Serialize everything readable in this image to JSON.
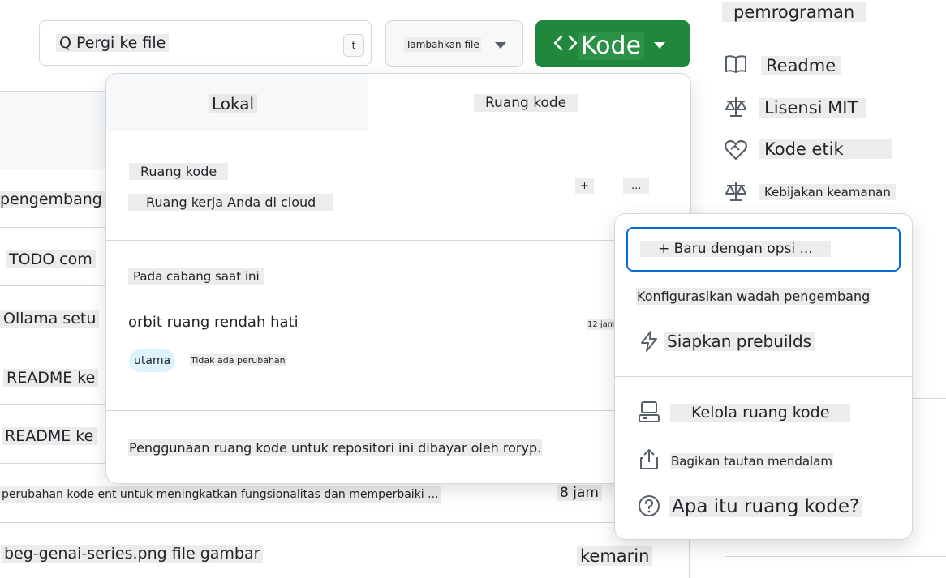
{
  "toolbar": {
    "search_text": "Q Pergi ke file",
    "search_shortcut": "t",
    "add_file_label": "Tambahkan file",
    "code_button_label": "Kode",
    "code_button_icon": "code-icon"
  },
  "file_rows": [
    {
      "text": "pengembang"
    },
    {
      "text": "TODO com"
    },
    {
      "text": "Ollama setu"
    },
    {
      "text": "README ke"
    },
    {
      "text": "README ke"
    },
    {
      "text": "perubahan kode ent untuk meningkatkan fungsionalitas dan memperbaiki ...",
      "time": "8 jam"
    },
    {
      "text": "beg-genai-series.png file gambar",
      "time": "kemarin"
    }
  ],
  "sidebar": {
    "heading": "pemrograman",
    "items": [
      {
        "label": "Readme",
        "icon": "book-icon"
      },
      {
        "label": "Lisensi MIT",
        "icon": "scale-icon"
      },
      {
        "label": "Kode etik",
        "icon": "heart-handshake-icon"
      },
      {
        "label": "Kebijakan keamanan",
        "icon": "scale-icon"
      }
    ]
  },
  "code_panel": {
    "tabs": [
      {
        "label": "Lokal"
      },
      {
        "label": "Ruang kode"
      }
    ],
    "section_title": "Ruang kode",
    "section_subtitle": "Ruang kerja Anda di cloud",
    "add_button": "+",
    "more_button": "...",
    "branch_heading": "Pada cabang saat ini",
    "codespace_name": "orbit ruang rendah hati",
    "codespace_time": "12 jam",
    "branch_name": "utama",
    "changes_text": "Tidak ada perubahan",
    "billing_text": "Penggunaan ruang kode untuk repositori ini dibayar oleh roryp."
  },
  "menu": {
    "items": [
      {
        "label": "+ Baru dengan opsi ..."
      },
      {
        "label": "Konfigurasikan wadah pengembang"
      },
      {
        "label": "Siapkan prebuilds",
        "icon": "zap-icon"
      },
      {
        "label": "Kelola ruang kode",
        "icon": "server-icon"
      },
      {
        "label": "Bagikan tautan mendalam",
        "icon": "share-icon"
      },
      {
        "label": "Apa itu ruang kode?",
        "icon": "question-icon"
      }
    ]
  },
  "colors": {
    "code_button": "#1f883d",
    "focus_ring": "#0969da",
    "branch_pill": "#ddf4ff"
  }
}
